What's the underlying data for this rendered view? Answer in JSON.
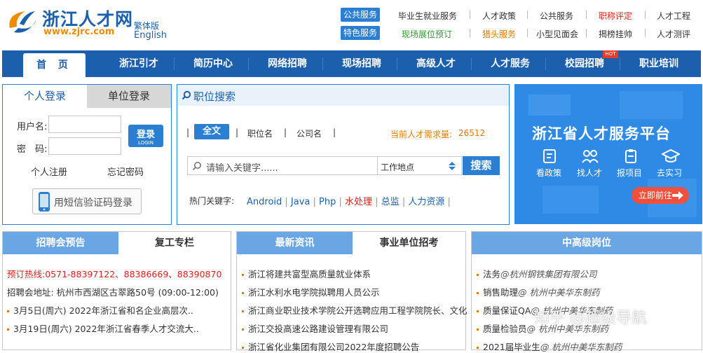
{
  "brand": {
    "name_cn": "浙江人才网",
    "url": "www.zjrc.com",
    "lang_trad": "繁体版",
    "lang_en": "English"
  },
  "services": {
    "public_tag": "公共服务",
    "special_tag": "特色服务",
    "row1": [
      "毕业生就业服务",
      "人才政策",
      "公共服务",
      "职称评定",
      "人才工程"
    ],
    "row2": [
      "现场展位预订",
      "猎头服务",
      "小型见面会",
      "揭榜挂帅",
      "人才测评"
    ]
  },
  "nav": [
    "首 页",
    "浙江引才",
    "简历中心",
    "网络招聘",
    "现场招聘",
    "高级人才",
    "人才服务",
    "校园招聘",
    "职业培训"
  ],
  "nav_hot": "HOT",
  "login": {
    "tab_personal": "个人登录",
    "tab_company": "单位登录",
    "username_label": "用户名:",
    "password_label": "密　码:",
    "login_btn": "登录",
    "login_btn_en": "LOGIN",
    "register": "个人注册",
    "forgot": "忘记密码",
    "sms_login": "用短信验证码登录"
  },
  "search": {
    "title": "职位搜索",
    "tabs": [
      "全文",
      "职位名",
      "公司名"
    ],
    "demand_label": "当前人才需求量:",
    "demand_value": "26512",
    "placeholder": "请输入关键字......",
    "location": "工作地点",
    "button": "搜索",
    "hot_label": "热门关键字:",
    "hot_keywords": [
      "Android",
      "Java",
      "Php",
      "水处理",
      "总监",
      "人力资源"
    ]
  },
  "banner": {
    "title": "浙江省人才服务平台",
    "items": [
      "看政策",
      "找人才",
      "报项目",
      "去实习"
    ],
    "cta": "立即前往"
  },
  "panel1": {
    "tab_active": "招聘会预告",
    "tab_other": "复工专栏",
    "hotline": "预订热线:0571-88397122、88386669、88390870",
    "address": "招聘会地址: 杭州市西湖区古翠路50号 (09:00-12:00)",
    "items": [
      "3月5日(周六) 2022年浙江省和名企业高层次..",
      "3月19日(周六) 2022年浙江省春季人才交流大.."
    ]
  },
  "panel2": {
    "tab_active": "最新资讯",
    "tab_other": "事业单位招考",
    "items": [
      "浙江将建共富型高质量就业体系",
      "浙江水利水电学院拟聘用人员公示",
      "浙江商业职业技术学院公开选聘应用工程学院院长、文化",
      "浙江交投高速公路建设管理有限公司",
      "浙江省化业集团有限公司2022年度招聘公告"
    ]
  },
  "panel3": {
    "tab_active": "中高级岗位",
    "items": [
      {
        "job": "法务",
        "company": "@杭州钢铁集团有限公司"
      },
      {
        "job": "销售助理",
        "company": "@ 杭州中美华东制药"
      },
      {
        "job": "质量保证QA",
        "company": "@ 杭州中美华东制药"
      },
      {
        "job": "质量检验员",
        "company": "@ 杭州中美华东制药"
      },
      {
        "job": "2021届毕业生",
        "company": "@ 杭州中美华东制药"
      }
    ]
  },
  "watermark": "知乎 @超级导航"
}
